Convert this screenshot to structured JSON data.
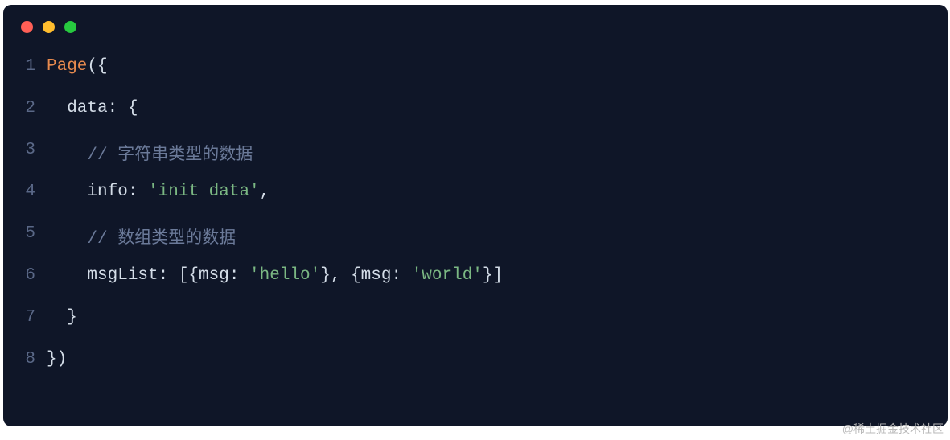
{
  "window": {
    "dots": {
      "red": "#ff5f56",
      "yellow": "#ffbd2e",
      "green": "#27c93f"
    }
  },
  "code": {
    "lines": {
      "n1": "1",
      "n2": "2",
      "n3": "3",
      "n4": "4",
      "n5": "5",
      "n6": "6",
      "n7": "7",
      "n8": "8",
      "l1_fn": "Page",
      "l1_rest": "({",
      "l2": "  data: {",
      "l3_prefix": "    ",
      "l3_comment": "// 字符串类型的数据",
      "l4_prefix": "    info: ",
      "l4_string": "'init data'",
      "l4_suffix": ",",
      "l5_prefix": "    ",
      "l5_comment": "// 数组类型的数据",
      "l6_prefix": "    msgList: [{msg: ",
      "l6_str1": "'hello'",
      "l6_mid": "}, {msg: ",
      "l6_str2": "'world'",
      "l6_suffix": "}]",
      "l7": "  }",
      "l8": "})"
    }
  },
  "watermark": "@稀土掘金技术社区"
}
